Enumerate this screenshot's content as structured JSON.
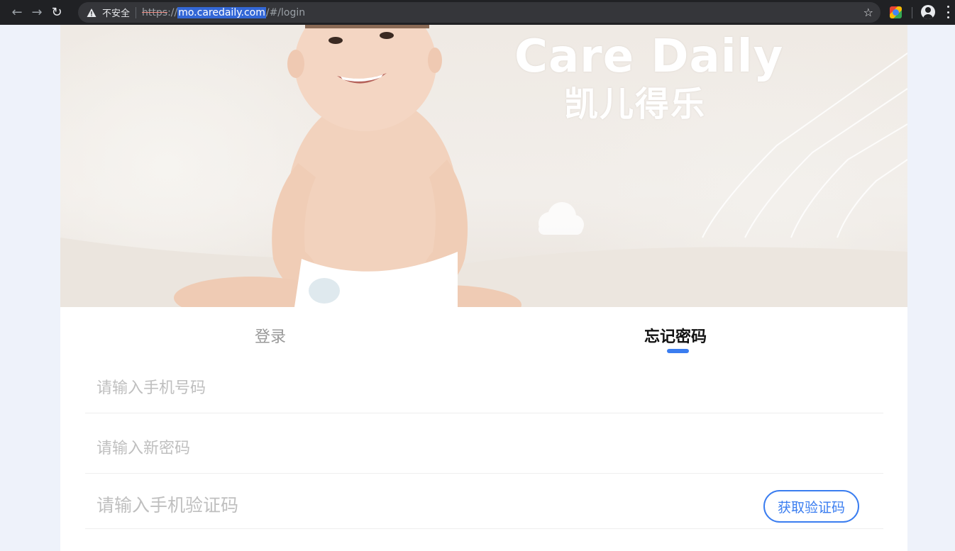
{
  "browser": {
    "security_label": "不安全",
    "url_scheme": "https",
    "url_scheme_sep": "://",
    "url_host": "mo.caredaily.com",
    "url_path": "/#/login",
    "icons": [
      "back-arrow-icon",
      "forward-arrow-icon",
      "reload-icon",
      "warning-icon",
      "star-icon",
      "extension-icon",
      "profile-icon",
      "menu-icon"
    ]
  },
  "hero": {
    "brand_en": "Care Daily",
    "brand_cn": "凯儿得乐"
  },
  "tabs": {
    "login": "登录",
    "forgot": "忘记密码",
    "active": "forgot"
  },
  "form": {
    "phone_placeholder": "请输入手机号码",
    "password_placeholder": "请输入新密码",
    "code_placeholder": "请输入手机验证码",
    "get_code_label": "获取验证码"
  },
  "colors": {
    "accent": "#3a7df0",
    "chrome_bg": "#202124",
    "page_bg": "#eef2fa"
  }
}
